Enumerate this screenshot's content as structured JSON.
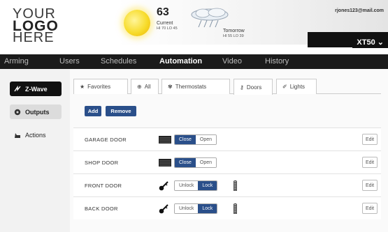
{
  "logo": {
    "line1": "YOUR",
    "line2": "LOGO",
    "line3": "HERE"
  },
  "weather": {
    "temp": "63",
    "current_label": "Current",
    "current_hilo": "HI 70   LO 45",
    "tomorrow_label": "Tomorrow",
    "tomorrow_hilo": "HI 55   LO 39"
  },
  "account": {
    "email": "rjones123@mail.com",
    "device": "XT50"
  },
  "nav": {
    "items": [
      "Arming",
      "Users",
      "Schedules",
      "Automation",
      "Video",
      "History"
    ],
    "active": "Automation"
  },
  "sidebar": {
    "items": [
      "Z-Wave",
      "Outputs",
      "Actions"
    ]
  },
  "tabs": [
    "Favorites",
    "All",
    "Thermostats",
    "Doors",
    "Lights"
  ],
  "buttons": {
    "add": "Add",
    "remove": "Remove",
    "edit": "Edit"
  },
  "devices": [
    {
      "name": "GARAGE DOOR",
      "options": [
        "Close",
        "Open"
      ],
      "selected": "Close"
    },
    {
      "name": "SHOP DOOR",
      "options": [
        "Close",
        "Open"
      ],
      "selected": "Close"
    },
    {
      "name": "FRONT DOOR",
      "options": [
        "Unlock",
        "Lock"
      ],
      "selected": "Lock"
    },
    {
      "name": "BACK DOOR",
      "options": [
        "Unlock",
        "Lock"
      ],
      "selected": "Lock"
    }
  ],
  "colors": {
    "accent": "#2a4f8a",
    "navbar": "#1b1b1b"
  }
}
